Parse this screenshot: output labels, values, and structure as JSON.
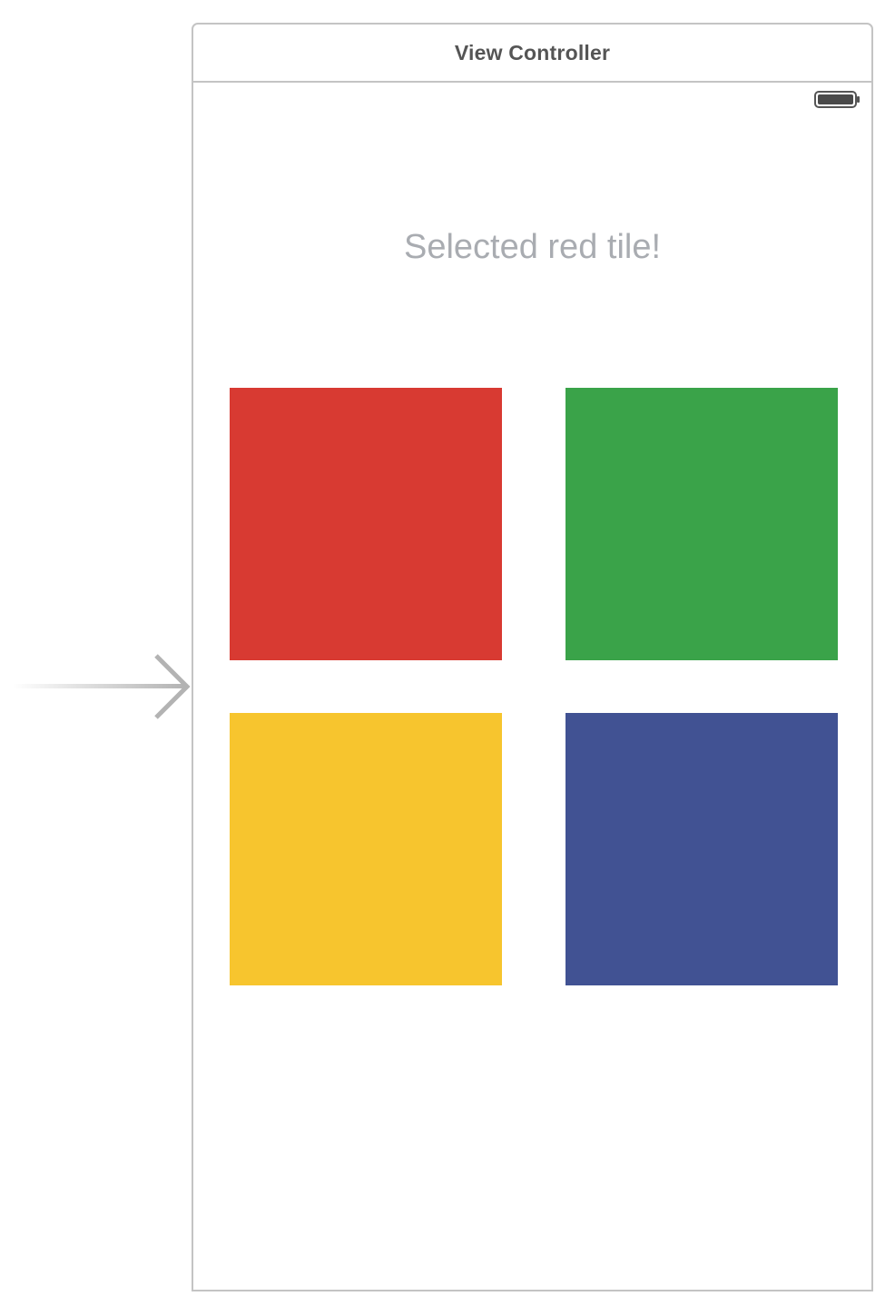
{
  "scene": {
    "title": "View Controller"
  },
  "status_bar": {
    "battery_icon": "battery-icon"
  },
  "main": {
    "status_label": "Selected red tile!"
  },
  "tiles": [
    {
      "name": "red",
      "color": "#d83a32"
    },
    {
      "name": "green",
      "color": "#3aa349"
    },
    {
      "name": "yellow",
      "color": "#f7c52e"
    },
    {
      "name": "blue",
      "color": "#415293"
    }
  ],
  "entry_point": {
    "icon": "initial-view-controller-arrow-icon"
  }
}
